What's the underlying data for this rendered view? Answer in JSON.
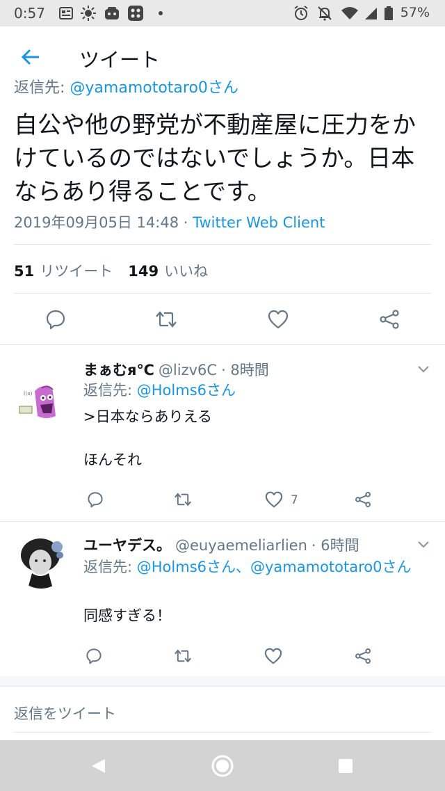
{
  "status_bar": {
    "time": "0:57",
    "battery": "57%",
    "icons": [
      "news-icon",
      "sun-icon",
      "game-icon",
      "app-grid-icon",
      "dot-icon",
      "alarm-icon",
      "notifications-off-icon",
      "wifi-icon",
      "signal-icon",
      "battery-icon"
    ]
  },
  "app_bar": {
    "title": "ツイート",
    "back_icon": "arrow-left-icon"
  },
  "tweet": {
    "reply_to_prefix": "返信先: ",
    "reply_to_handle": "@yamamototaro0さん",
    "text": "自公や他の野党が不動産屋に圧力をかけているのではないでしょうか。日本ならあり得ることです。",
    "date": "2019年09月05日 14:48",
    "separator": " · ",
    "client": "Twitter Web Client",
    "retweets_count": "51",
    "retweets_label": "リツイート",
    "likes_count": "149",
    "likes_label": "いいね"
  },
  "replies": [
    {
      "name": "まぁむя℃",
      "handle": "@lizv6C",
      "time": "· 8時間",
      "reply_to_prefix": "返信先: ",
      "reply_to": "@Holms6さん",
      "reply_to_rest": "",
      "text": ">日本ならありえる\n\nほんそれ",
      "like_count": "7"
    },
    {
      "name": "ユーヤデス。",
      "handle": "@euyaemeliarlien",
      "time": "· 6時間",
      "reply_to_prefix": "返信先: ",
      "reply_to": "@Holms6さん、@yamamototaro0さん",
      "reply_to_rest": "",
      "text": "同感すぎる！",
      "like_count": ""
    }
  ],
  "compose": {
    "placeholder": "返信をツイート"
  },
  "colors": {
    "accent": "#1b95e0",
    "text": "#14171a",
    "secondary": "#657786",
    "divider": "#e1e8ed",
    "status_bar": "#e9e9e9",
    "nav_bar": "#d3d3d3"
  }
}
